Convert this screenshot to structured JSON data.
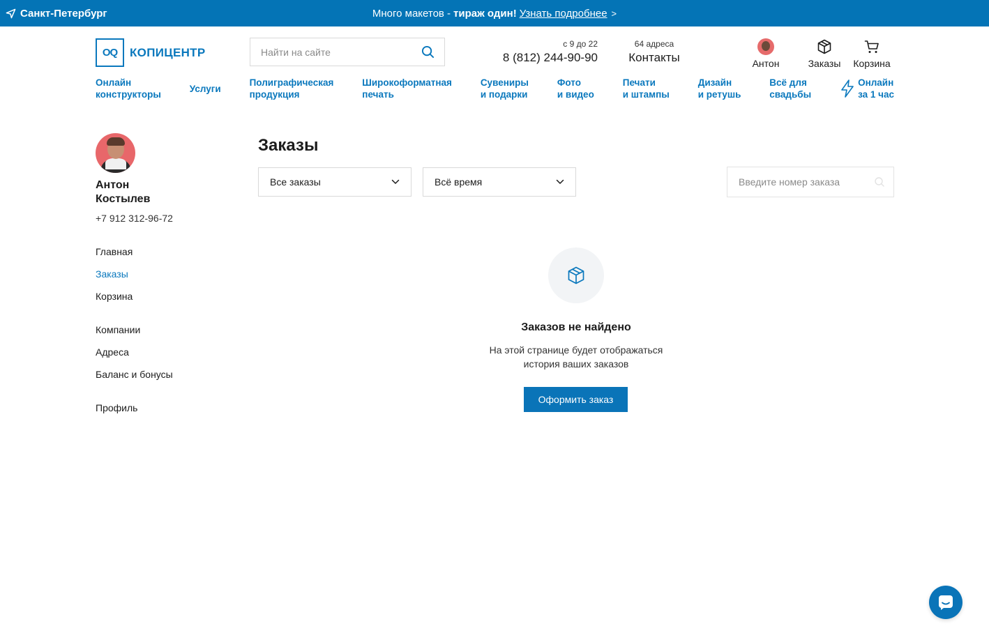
{
  "topbar": {
    "city": "Санкт-Петербург",
    "promo_prefix": "Много макетов - ",
    "promo_bold": "тираж один!",
    "promo_link": "Узнать подробнее",
    "promo_chevron": ">"
  },
  "header": {
    "logo_mark": "OQ",
    "logo_text": "КОПИЦЕНТР",
    "search_placeholder": "Найти на сайте",
    "hours": "с 9 до 22",
    "phone": "8 (812) 244-90-90",
    "addresses": "64 адреса",
    "contacts": "Контакты",
    "user_label": "Антон",
    "orders_label": "Заказы",
    "cart_label": "Корзина"
  },
  "nav": [
    "Онлайн\nконструкторы",
    "Услуги",
    "Полиграфическая\nпродукция",
    "Широкоформатная\nпечать",
    "Сувениры\nи подарки",
    "Фото\nи видео",
    "Печати\nи штампы",
    "Дизайн\nи ретушь",
    "Всё для\nсвадьбы",
    "Онлайн\nза 1 час"
  ],
  "profile": {
    "name": "Антон\nКостылев",
    "phone": "+7 912 312-96-72"
  },
  "menu": {
    "home": "Главная",
    "orders": "Заказы",
    "cart": "Корзина",
    "companies": "Компании",
    "addresses": "Адреса",
    "balance": "Баланс и бонусы",
    "profile": "Профиль"
  },
  "main": {
    "title": "Заказы",
    "filter_status": "Все заказы",
    "filter_period": "Всё время",
    "order_search_placeholder": "Введите номер заказа",
    "empty_title": "Заказов не найдено",
    "empty_text": "На этой странице будет отображаться\nистория ваших заказов",
    "cta": "Оформить заказ"
  },
  "colors": {
    "brand": "#0474b6",
    "link": "#0a78bd",
    "button": "#0a74b8"
  }
}
